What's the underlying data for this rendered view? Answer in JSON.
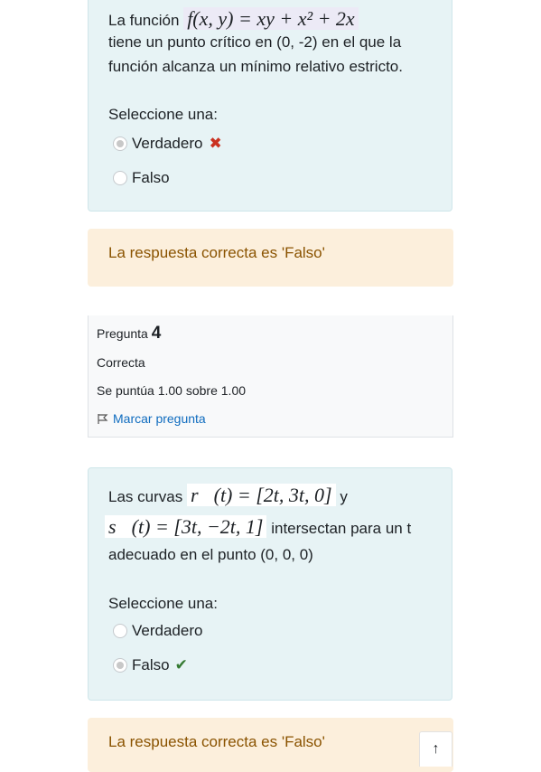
{
  "question3": {
    "text_before_math": "La función",
    "math": "f(x, y) = xy + x² + 2x",
    "line2": "tiene un punto crítico en (0, -2) en el que la",
    "line3": "función alcanza un mínimo relativo estricto.",
    "prompt": "Seleccione una:",
    "options": [
      {
        "label": "Verdadero",
        "selected": true,
        "mark": "incorrect"
      },
      {
        "label": "Falso",
        "selected": false,
        "mark": ""
      }
    ],
    "mark_symbol": "✖",
    "feedback": "La respuesta correcta es 'Falso'"
  },
  "question4": {
    "header_prefix": "Pregunta",
    "number": "4",
    "status": "Correcta",
    "grade": "Se puntúa 1.00 sobre 1.00",
    "flag_label": "Marcar pregunta",
    "text_before": "Las curvas",
    "math_r": "r⃗(t) = [2t, 3t, 0]",
    "connector": "y",
    "math_s": "s⃗(t) = [3t, −2t, 1]",
    "text_after": "intersectan para un t",
    "line3": "adecuado en el punto (0, 0, 0)",
    "prompt": "Seleccione una:",
    "options": [
      {
        "label": "Verdadero",
        "selected": false,
        "mark": ""
      },
      {
        "label": "Falso",
        "selected": true,
        "mark": "correct"
      }
    ],
    "mark_symbol": "✔",
    "feedback": "La respuesta correcta es 'Falso'"
  },
  "back_to_top_icon": "↑",
  "colors": {
    "qtext_bg": "#e7f3f5",
    "feedback_bg": "#fcefdc",
    "feedback_text": "#8a5300",
    "incorrect": "#ca3120",
    "correct": "#357a32",
    "link": "#0f6cbf"
  }
}
